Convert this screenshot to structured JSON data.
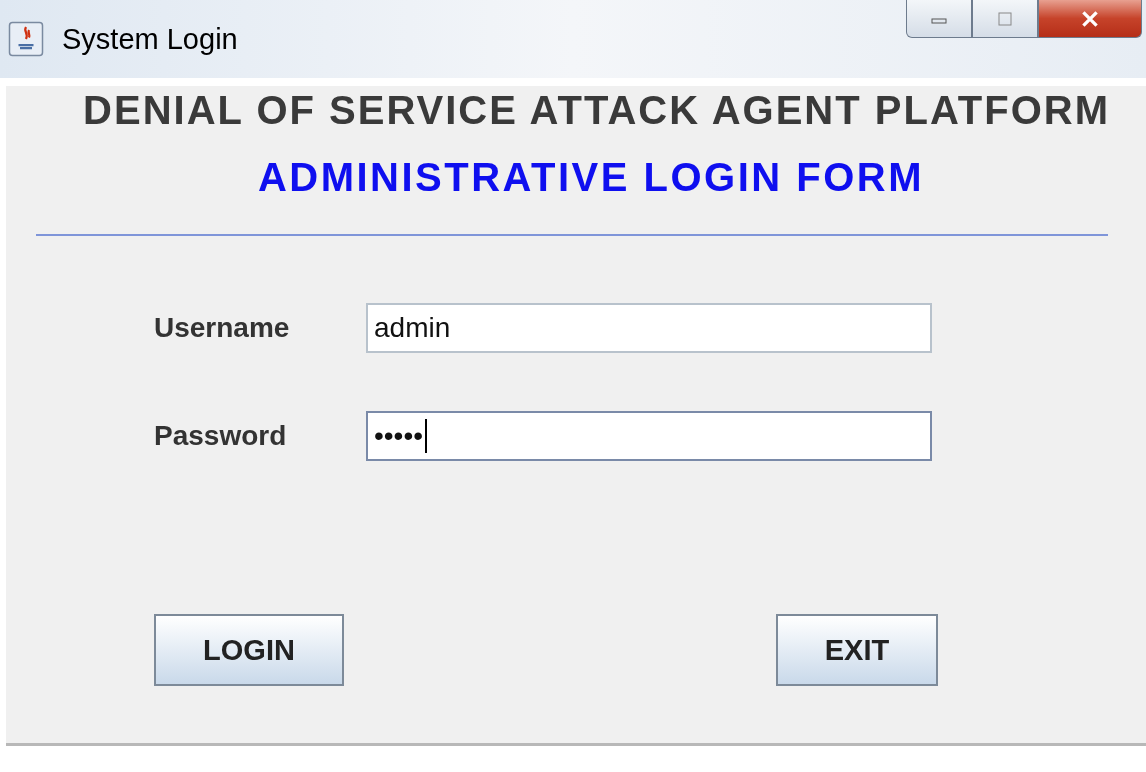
{
  "window": {
    "title": "System Login"
  },
  "heading": "DENIAL OF SERVICE ATTACK AGENT PLATFORM",
  "subheading": "ADMINISTRATIVE LOGIN FORM",
  "fields": [
    {
      "label": "Username",
      "value": "admin",
      "focused": false
    },
    {
      "label": "Password",
      "value": "•••••",
      "focused": true
    }
  ],
  "buttons": [
    "LOGIN",
    "EXIT"
  ]
}
